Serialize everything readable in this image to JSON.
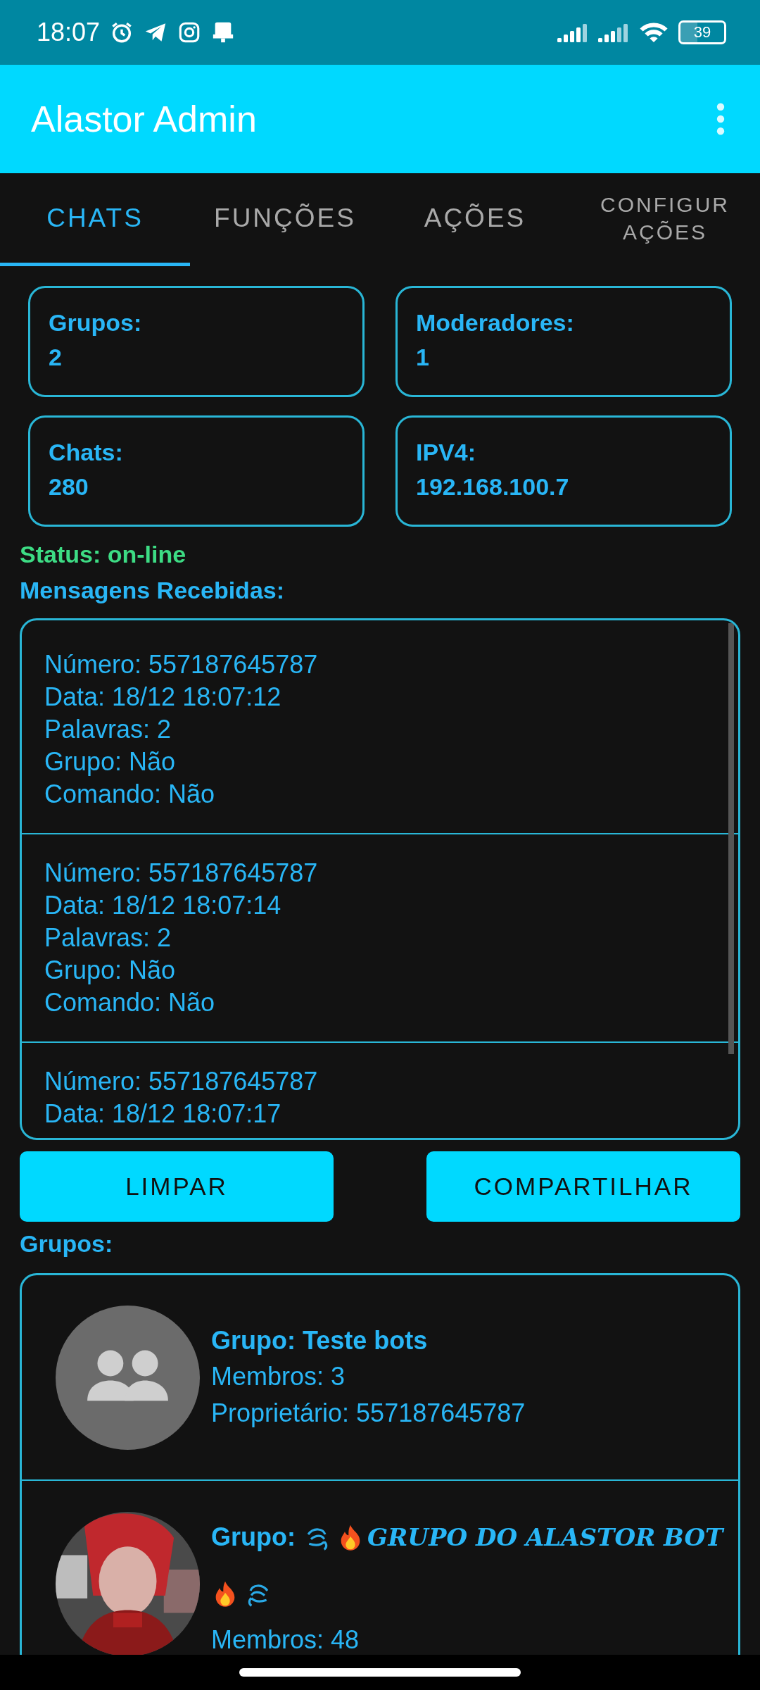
{
  "status_bar": {
    "time": "18:07",
    "battery": "39"
  },
  "app_bar": {
    "title": "Alastor Admin"
  },
  "tabs": [
    {
      "label": "CHATS",
      "selected": true
    },
    {
      "label": "FUNÇÕES",
      "selected": false
    },
    {
      "label": "AÇÕES",
      "selected": false
    },
    {
      "label": "CONFIGURAÇÕES",
      "selected": false
    }
  ],
  "stats": [
    {
      "label": "Grupos:",
      "value": "2"
    },
    {
      "label": "Moderadores:",
      "value": "1"
    },
    {
      "label": "Chats:",
      "value": "280"
    },
    {
      "label": "IPV4:",
      "value": "192.168.100.7"
    }
  ],
  "status": "Status: on-line",
  "messages_title": "Mensagens Recebidas:",
  "messages": [
    {
      "lines": [
        "Número: 557187645787",
        "Data: 18/12 18:07:12",
        "Palavras: 2",
        "Grupo: Não",
        "Comando: Não"
      ]
    },
    {
      "lines": [
        "Número: 557187645787",
        "Data: 18/12 18:07:14",
        "Palavras: 2",
        "Grupo: Não",
        "Comando: Não"
      ]
    },
    {
      "lines": [
        "Número: 557187645787",
        "Data: 18/12 18:07:17"
      ]
    }
  ],
  "buttons": [
    "LIMPAR",
    "COMPARTILHAR"
  ],
  "groups_title": "Grupos:",
  "groups": [
    {
      "kind": "plain",
      "label": "Grupo:",
      "name": "Teste bots",
      "lines": [
        "Membros: 3",
        "Proprietário: 557187645787"
      ]
    },
    {
      "kind": "decorated",
      "label": "Grupo:",
      "name": "GRUPO DO ALASTOR BOT",
      "lines": [
        "Membros: 48"
      ]
    }
  ]
}
